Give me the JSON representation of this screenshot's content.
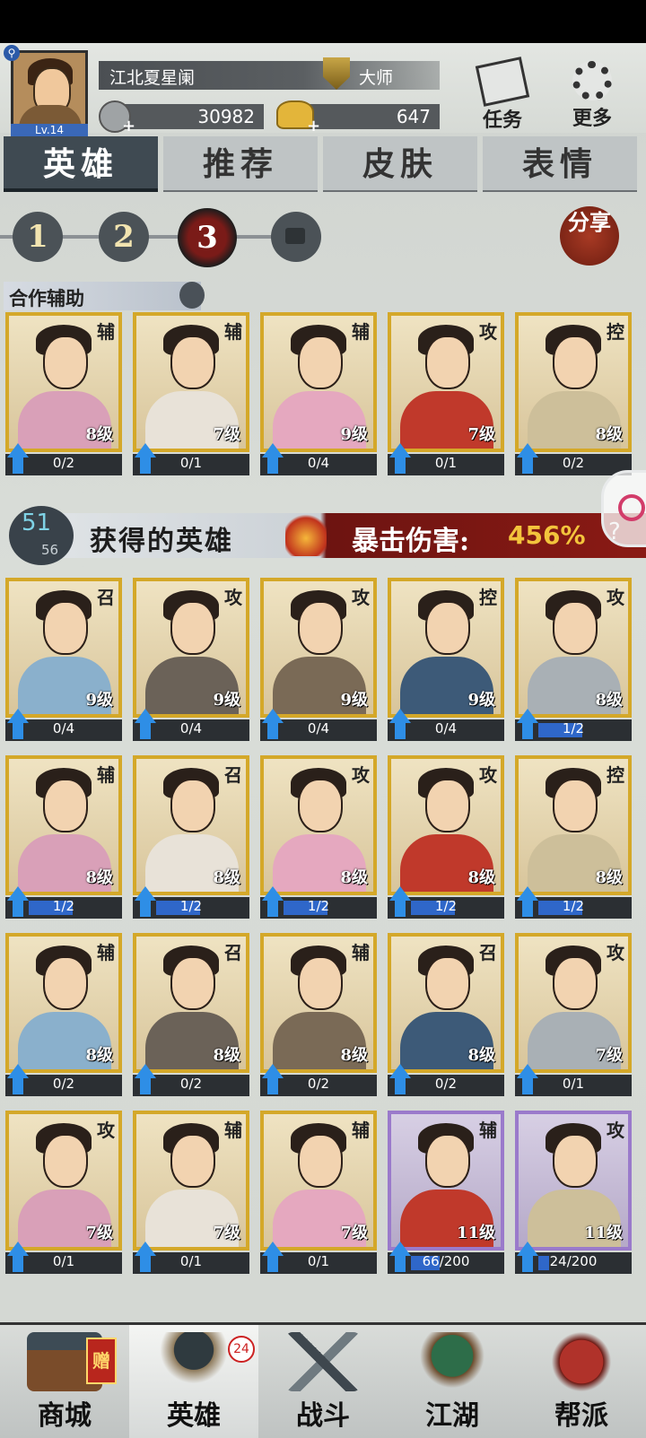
{
  "player": {
    "level": "Lv.14",
    "name": "江北夏星阑",
    "rank": "大师",
    "coins": "30982",
    "gold": "647"
  },
  "top_buttons": {
    "task": "任务",
    "more": "更多"
  },
  "tabs": [
    "英雄",
    "推荐",
    "皮肤",
    "表情"
  ],
  "active_tab": "英雄",
  "pages": [
    "1",
    "2",
    "3"
  ],
  "active_page": "3",
  "share_label": "分享",
  "coop": {
    "title": "合作辅助",
    "heroes": [
      {
        "role": "辅",
        "level": "8级",
        "progress": "0/2",
        "fill": 0
      },
      {
        "role": "辅",
        "level": "7级",
        "progress": "0/1",
        "fill": 0
      },
      {
        "role": "辅",
        "level": "9级",
        "progress": "0/4",
        "fill": 0
      },
      {
        "role": "攻",
        "level": "7级",
        "progress": "0/1",
        "fill": 0
      },
      {
        "role": "控",
        "level": "8级",
        "progress": "0/2",
        "fill": 0
      }
    ]
  },
  "obtained": {
    "count": "51",
    "total": "56",
    "title": "获得的英雄",
    "crit_label": "暴击伤害:",
    "crit_value": "456%"
  },
  "heroes": [
    {
      "role": "召",
      "level": "9级",
      "progress": "0/4",
      "fill": 0,
      "tier": "gold"
    },
    {
      "role": "攻",
      "level": "9级",
      "progress": "0/4",
      "fill": 0,
      "tier": "gold"
    },
    {
      "role": "攻",
      "level": "9级",
      "progress": "0/4",
      "fill": 0,
      "tier": "gold"
    },
    {
      "role": "控",
      "level": "9级",
      "progress": "0/4",
      "fill": 0,
      "tier": "gold"
    },
    {
      "role": "攻",
      "level": "8级",
      "progress": "1/2",
      "fill": 0.5,
      "tier": "gold"
    },
    {
      "role": "辅",
      "level": "8级",
      "progress": "1/2",
      "fill": 0.5,
      "tier": "gold"
    },
    {
      "role": "召",
      "level": "8级",
      "progress": "1/2",
      "fill": 0.5,
      "tier": "gold"
    },
    {
      "role": "攻",
      "level": "8级",
      "progress": "1/2",
      "fill": 0.5,
      "tier": "gold"
    },
    {
      "role": "攻",
      "level": "8级",
      "progress": "1/2",
      "fill": 0.5,
      "tier": "gold"
    },
    {
      "role": "控",
      "level": "8级",
      "progress": "1/2",
      "fill": 0.5,
      "tier": "gold"
    },
    {
      "role": "辅",
      "level": "8级",
      "progress": "0/2",
      "fill": 0,
      "tier": "gold"
    },
    {
      "role": "召",
      "level": "8级",
      "progress": "0/2",
      "fill": 0,
      "tier": "gold"
    },
    {
      "role": "辅",
      "level": "8级",
      "progress": "0/2",
      "fill": 0,
      "tier": "gold"
    },
    {
      "role": "召",
      "level": "8级",
      "progress": "0/2",
      "fill": 0,
      "tier": "gold"
    },
    {
      "role": "攻",
      "level": "7级",
      "progress": "0/1",
      "fill": 0,
      "tier": "gold"
    },
    {
      "role": "攻",
      "level": "7级",
      "progress": "0/1",
      "fill": 0,
      "tier": "gold"
    },
    {
      "role": "辅",
      "level": "7级",
      "progress": "0/1",
      "fill": 0,
      "tier": "gold"
    },
    {
      "role": "辅",
      "level": "7级",
      "progress": "0/1",
      "fill": 0,
      "tier": "gold"
    },
    {
      "role": "辅",
      "level": "11级",
      "progress": "66/200",
      "fill": 0.33,
      "tier": "purple"
    },
    {
      "role": "攻",
      "level": "11级",
      "progress": "24/200",
      "fill": 0.12,
      "tier": "purple"
    }
  ],
  "bottom_nav": [
    {
      "label": "商城",
      "icon": "shop-icon",
      "badge": "赠"
    },
    {
      "label": "英雄",
      "icon": "hero-icon",
      "badge": "24"
    },
    {
      "label": "战斗",
      "icon": "battle-swords-icon"
    },
    {
      "label": "江湖",
      "icon": "world-tree-icon"
    },
    {
      "label": "帮派",
      "icon": "guild-emblem-icon"
    }
  ],
  "active_nav": "英雄"
}
